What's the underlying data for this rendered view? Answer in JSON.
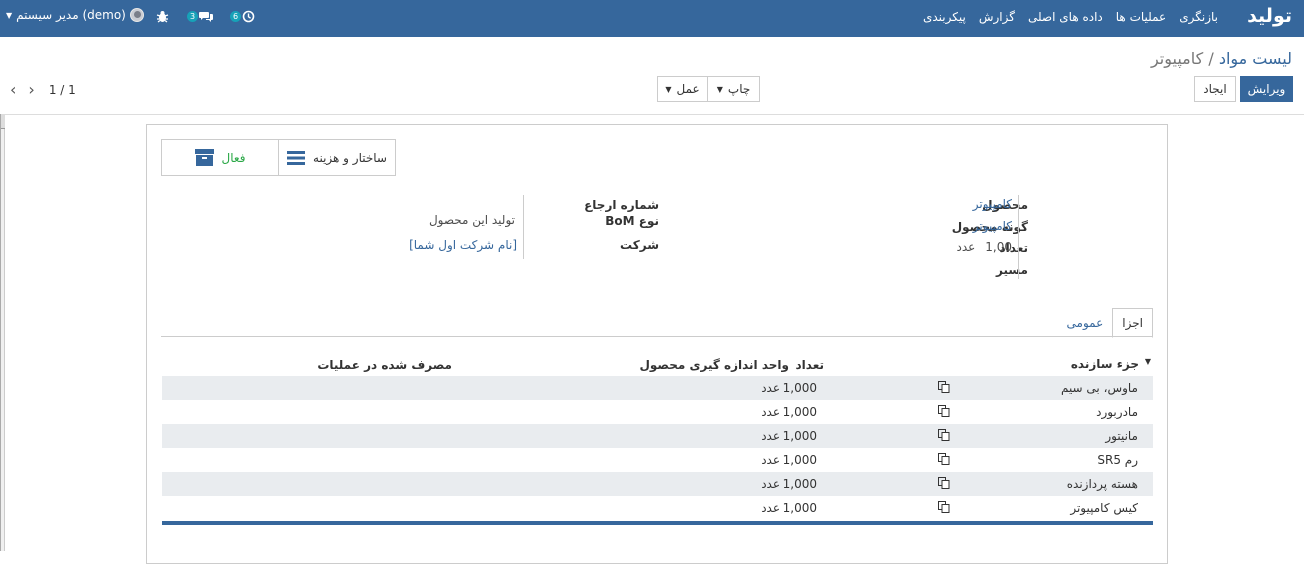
{
  "navbar": {
    "brand": "تولید",
    "menu": [
      "بازنگری",
      "عملیات ها",
      "داده های اصلی",
      "گزارش",
      "پیکربندی"
    ],
    "user_name": "مدیر سیستم (demo)",
    "chat_count": "3",
    "activity_count": "6"
  },
  "breadcrumb": {
    "parent": "لیست مواد",
    "separator": "/",
    "current": "کامپیوتر"
  },
  "buttons": {
    "edit": "ویرایش",
    "create": "ایجاد",
    "print": "چاپ",
    "action": "عمل"
  },
  "pager": {
    "value": "1 / 1"
  },
  "button_box": {
    "structure": "ساختار و هزینه",
    "active": "فعال"
  },
  "fields": {
    "product_label": "محصول",
    "product_value": "کامپیوتر",
    "variant_label": "گونه محصول",
    "variant_value": "کامپیوتر",
    "qty_label": "تعداد",
    "qty_value": "1,00",
    "qty_uom": "عدد",
    "route_label": "مسیر",
    "ref_label": "شماره ارجاع",
    "bom_type_label": "نوع BoM",
    "bom_type_value": "تولید این محصول",
    "company_label": "شرکت",
    "company_value": "[نام شرکت اول شما]"
  },
  "tabs": [
    "اجزا",
    "عمومی"
  ],
  "table": {
    "headers": {
      "component": "جزء سازنده",
      "qty": "تعداد",
      "uom": "واحد اندازه گیری محصول",
      "consumed": "مصرف شده در عملیات"
    },
    "rows": [
      {
        "name": "ماوس، بی سیم",
        "qty": "1,000",
        "uom": "عدد"
      },
      {
        "name": "مادربورد",
        "qty": "1,000",
        "uom": "عدد"
      },
      {
        "name": "مانیتور",
        "qty": "1,000",
        "uom": "عدد"
      },
      {
        "name": "رم SR5",
        "qty": "1,000",
        "uom": "عدد"
      },
      {
        "name": "هسته پردازنده",
        "qty": "1,000",
        "uom": "عدد"
      },
      {
        "name": "کیس کامپیوتر",
        "qty": "1,000",
        "uom": "عدد"
      }
    ]
  }
}
